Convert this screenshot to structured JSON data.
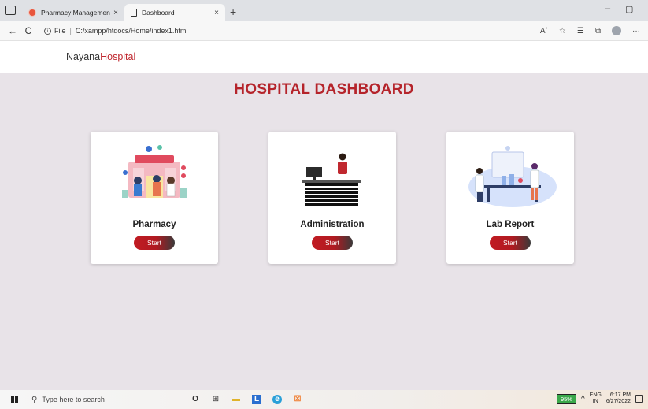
{
  "browser": {
    "tabs": [
      {
        "title": "Pharmacy Management - Login",
        "close": "×"
      },
      {
        "title": "Dashboard",
        "close": "×"
      }
    ],
    "new_tab": "+",
    "window_controls": {
      "minimize": "–",
      "restore": "▢"
    },
    "nav": {
      "back": "←",
      "reload": "C"
    },
    "address": {
      "prefix": "File",
      "url": "C:/xampp/htdocs/Home/index1.html"
    },
    "toolbar_icons": [
      "read-aloud-icon",
      "favorite-icon",
      "favorites-list-icon",
      "collections-icon",
      "profile-icon",
      "more-icon"
    ],
    "toolbar_glyphs": {
      "read": "Aʾ",
      "fav": "☆",
      "favlist": "☰",
      "collections": "⧉",
      "more": "···"
    }
  },
  "site": {
    "brand_main": "Nayana",
    "brand_accent": "Hospital",
    "accent_color": "#c0282f"
  },
  "dashboard": {
    "title": "HOSPITAL DASHBOARD",
    "cards": [
      {
        "label": "Pharmacy",
        "button": "Start",
        "illustration": "pharmacy-illustration"
      },
      {
        "label": "Administration",
        "button": "Start",
        "illustration": "reception-desk-illustration"
      },
      {
        "label": "Lab Report",
        "button": "Start",
        "illustration": "laboratory-illustration"
      }
    ]
  },
  "taskbar": {
    "search_placeholder": "Type here to search",
    "apps": {
      "cortana": "O",
      "task_view": "⊞",
      "explorer": "▬",
      "app_l": "L",
      "edge": "e",
      "xampp": "☒"
    },
    "tray": {
      "battery": "95%",
      "chevron": "^",
      "lang_1": "ENG",
      "lang_2": "IN",
      "time": "6:17 PM",
      "date": "6/27/2022"
    }
  }
}
